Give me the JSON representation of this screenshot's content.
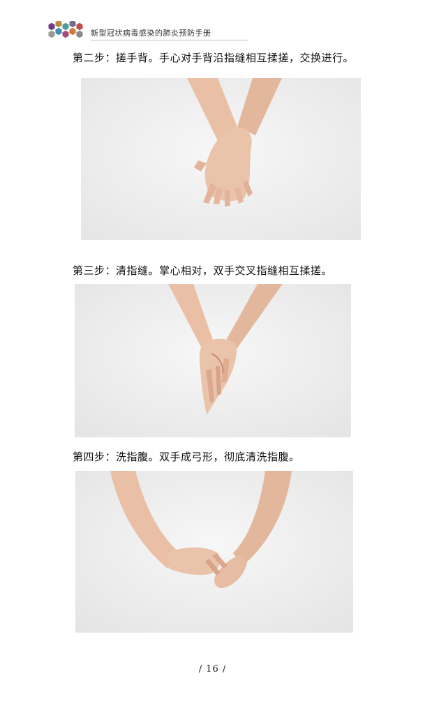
{
  "header": {
    "title": "新型冠状病毒感染的肺炎预防手册",
    "logo_colors": [
      "#6b3b86",
      "#b98b40",
      "#4f9b9c",
      "#7b6a8f",
      "#c34d4d",
      "#999999",
      "#3e8fb0",
      "#a64c7b",
      "#d07a3a",
      "#8a8a8a"
    ]
  },
  "steps": [
    {
      "text": "第二步：搓手背。手心对手背沿指缝相互揉搓，交换进行。"
    },
    {
      "text": "第三步：清指缝。掌心相对，双手交叉指缝相互揉搓。"
    },
    {
      "text": "第四步：洗指腹。双手成弓形，彻底清洗指腹。"
    }
  ],
  "footer": {
    "page_number": "/   16   /"
  },
  "colors": {
    "skin": "#e9c0a6",
    "skin_shadow": "#d39a80",
    "photo_bg": "#f1f1f1"
  }
}
